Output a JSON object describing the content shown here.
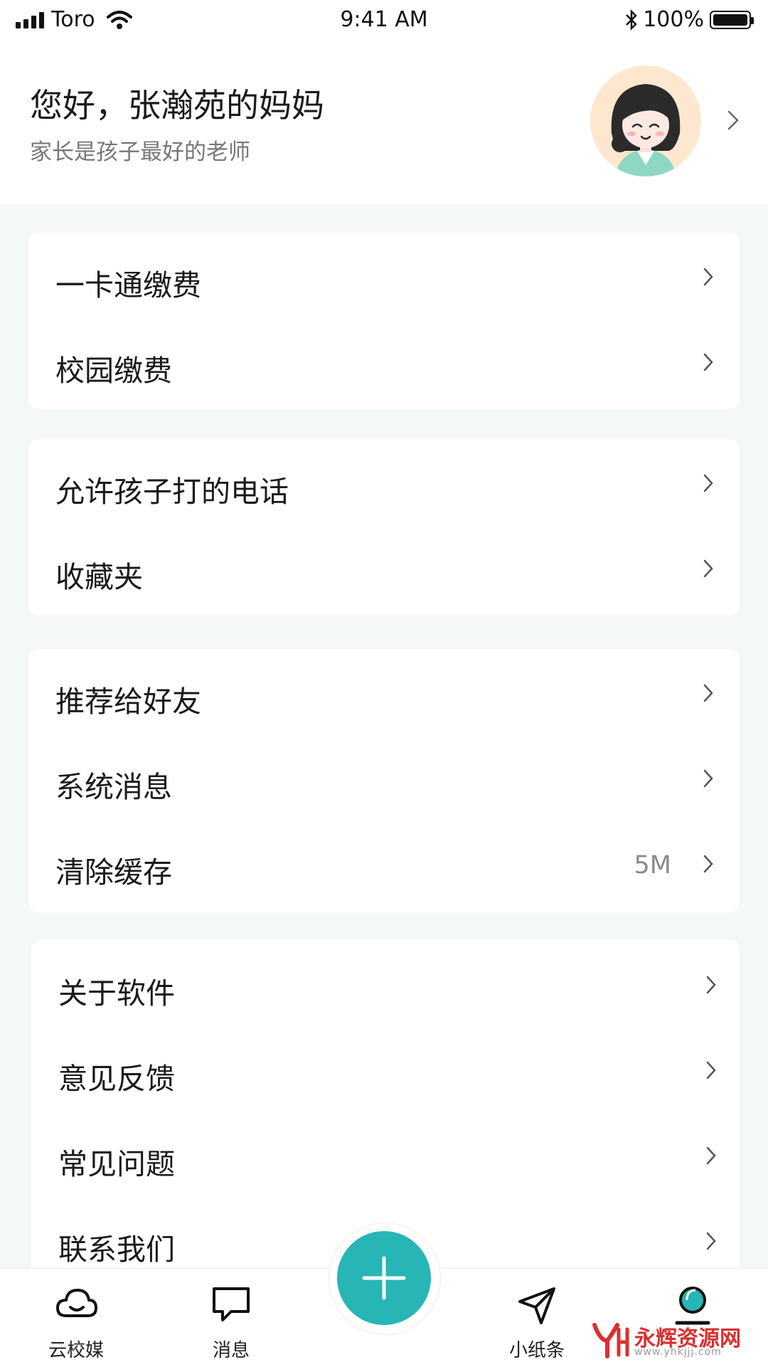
{
  "status_bar": {
    "carrier": "Toro",
    "time": "9:41 AM",
    "battery": "100%"
  },
  "header": {
    "greeting": "您好，张瀚苑的妈妈",
    "subtitle": "家长是孩子最好的老师"
  },
  "groups": [
    {
      "items": [
        {
          "label": "一卡通缴费"
        },
        {
          "label": "校园缴费"
        }
      ]
    },
    {
      "items": [
        {
          "label": "允许孩子打的电话"
        },
        {
          "label": "收藏夹"
        }
      ]
    },
    {
      "items": [
        {
          "label": "推荐给好友"
        },
        {
          "label": "系统消息"
        },
        {
          "label": "清除缓存",
          "value": "5M"
        }
      ]
    },
    {
      "items": [
        {
          "label": "关于软件"
        },
        {
          "label": "意见反馈"
        },
        {
          "label": "常见问题"
        },
        {
          "label": "联系我们"
        }
      ]
    }
  ],
  "tabbar": {
    "tabs": [
      {
        "label": "云校媒",
        "icon": "cloud-icon"
      },
      {
        "label": "消息",
        "icon": "chat-bubble-icon"
      },
      {
        "label": "小纸条",
        "icon": "paper-plane-icon"
      },
      {
        "label": "",
        "icon": "profile-icon"
      }
    ],
    "fab_icon": "plus-icon"
  },
  "watermark": {
    "text": "永辉资源网",
    "url": "www.yhkjjj.com"
  },
  "colors": {
    "accent": "#27b5b5",
    "background": "#f5f8f8"
  }
}
